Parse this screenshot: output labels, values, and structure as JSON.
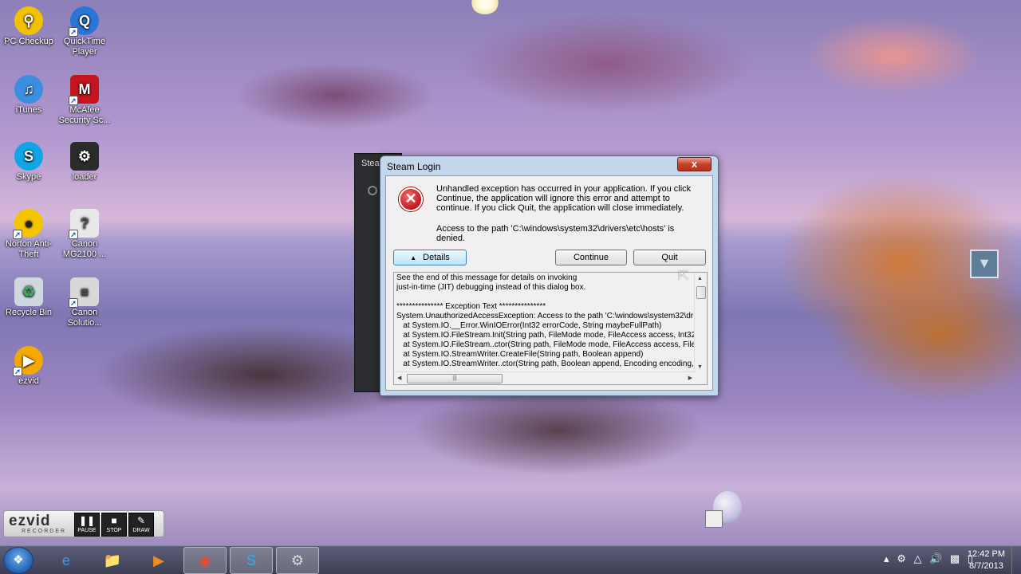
{
  "desktop": {
    "icons": [
      {
        "label": "PC Checkup",
        "icon": "magnifier-icon"
      },
      {
        "label": "QuickTime Player",
        "icon": "quicktime-icon"
      },
      {
        "label": "iTunes",
        "icon": "itunes-icon"
      },
      {
        "label": "McAfee Security Sc...",
        "icon": "mcafee-shield-icon"
      },
      {
        "label": "Skype",
        "icon": "skype-icon"
      },
      {
        "label": "loader",
        "icon": "steam-icon"
      },
      {
        "label": "Norton Anti-Theft",
        "icon": "norton-icon"
      },
      {
        "label": "Canon MG2100 ...",
        "icon": "canon-printer-icon"
      },
      {
        "label": "Recycle Bin",
        "icon": "recycle-bin-icon"
      },
      {
        "label": "Canon Solutio...",
        "icon": "canon-solution-icon"
      },
      {
        "label": "ezvid",
        "icon": "ezvid-icon"
      }
    ]
  },
  "background_window": {
    "title": "Steam"
  },
  "dialog": {
    "title": "Steam Login",
    "close_label": "x",
    "message": "Unhandled exception has occurred in your application. If you click Continue, the application will ignore this error and attempt to continue. If you click Quit, the application will close immediately.",
    "message_detail": "Access to the path 'C:\\windows\\system32\\drivers\\etc\\hosts' is denied.",
    "details_label": "Details",
    "continue_label": "Continue",
    "quit_label": "Quit",
    "details_text": "See the end of this message for details on invoking\njust-in-time (JIT) debugging instead of this dialog box.\n\n*************** Exception Text ***************\nSystem.UnauthorizedAccessException: Access to the path 'C:\\windows\\system32\\dr\n   at System.IO.__Error.WinIOError(Int32 errorCode, String maybeFullPath)\n   at System.IO.FileStream.Init(String path, FileMode mode, FileAccess access, Int32 r\n   at System.IO.FileStream..ctor(String path, FileMode mode, FileAccess access, FileS\n   at System.IO.StreamWriter.CreateFile(String path, Boolean append)\n   at System.IO.StreamWriter..ctor(String path, Boolean append, Encoding encoding,"
  },
  "recorder": {
    "logo": "ezvid",
    "sub": "RECORDER",
    "pause_label": "PAUSE",
    "stop_label": "STOP",
    "draw_label": "DRAW"
  },
  "taskbar": {
    "pinned": [
      "internet-explorer-icon",
      "file-explorer-icon",
      "media-player-icon",
      "chrome-icon",
      "skype-icon",
      "steam-icon"
    ],
    "clock_time": "12:42 PM",
    "clock_date": "8/7/2013"
  },
  "colors": {
    "dialog_frame": "#c4d6eb",
    "close_button": "#c7412a",
    "error_icon": "#c4161c",
    "taskbar": "#3c3e54"
  }
}
